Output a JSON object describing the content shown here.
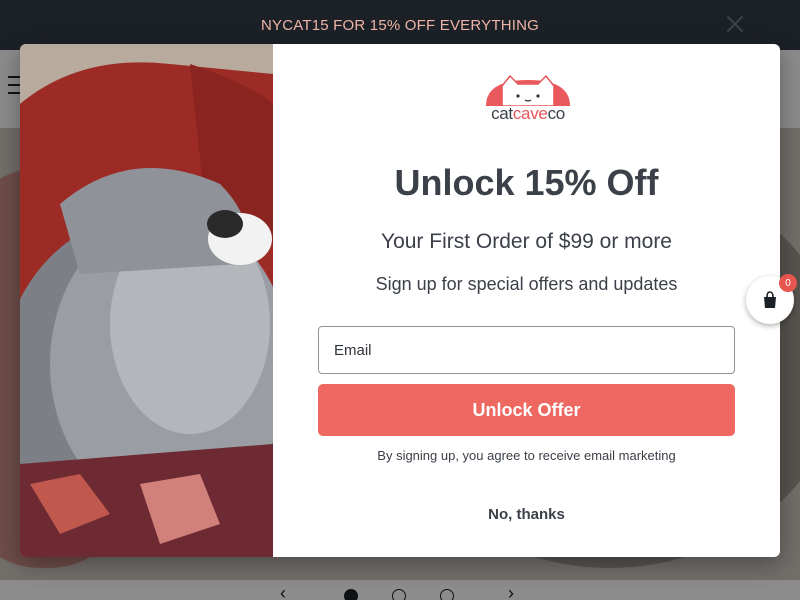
{
  "announcement": {
    "text": "NYCAT15 FOR 15% OFF EVERYTHING"
  },
  "header": {
    "menu_icon": "hamburger-icon"
  },
  "slider": {
    "prev_icon": "chevron-left-icon",
    "next_icon": "chevron-right-icon",
    "dot_count": 3,
    "active_index": 0
  },
  "cart": {
    "icon": "cart-icon",
    "count": "0"
  },
  "popup": {
    "close_icon": "close-icon",
    "logo": {
      "part1": "cat",
      "part2": "cave",
      "part3": "co"
    },
    "title": "Unlock 15% Off",
    "subtitle": "Your First Order of $99 or more",
    "tagline": "Sign up for special offers and updates",
    "email_placeholder": "Email",
    "submit_label": "Unlock Offer",
    "consent": "By signing up, you agree to receive email marketing",
    "dismiss_label": "No, thanks"
  },
  "colors": {
    "accent": "#ee6761",
    "dark": "#1c2127",
    "text": "#3b4049"
  }
}
